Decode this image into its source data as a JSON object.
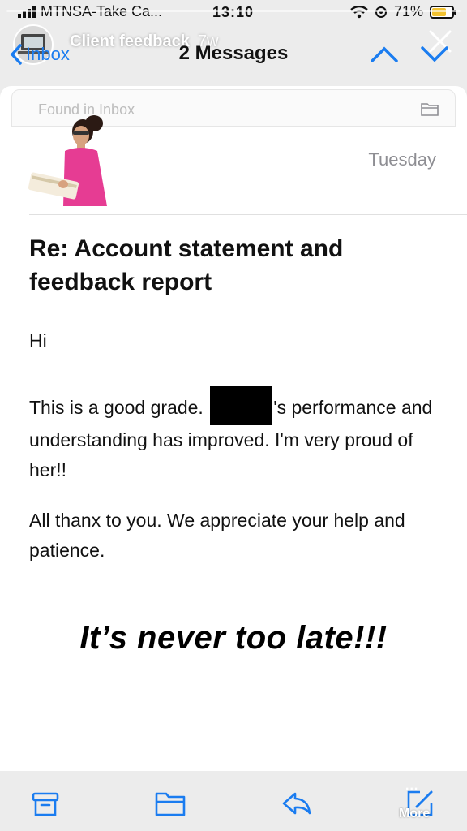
{
  "status_bar": {
    "carrier": "MTNSA-Take Ca...",
    "time": "13:10",
    "battery": "71%",
    "battery_level": 0.71
  },
  "story": {
    "title": "Client feedback",
    "age": "7w",
    "close_icon": "close-icon"
  },
  "nav": {
    "back_label": "Inbox",
    "title": "2 Messages",
    "up_icon": "chevron-up-icon",
    "down_icon": "chevron-down-icon"
  },
  "message": {
    "found_in": "Found in Inbox",
    "date": "Tuesday",
    "subject": "Re:  Account statement and feedback report",
    "greeting": "Hi",
    "para1_start": "This is a good grade.",
    "para1_end": "'s performance and understanding has improved. I'm very proud of her!!",
    "para2": "All thanx to you. We appreciate your help and patience."
  },
  "overlay_text": "It’s never too late!!!",
  "toolbar": {
    "more_label": "More",
    "more_dots": "...",
    "icons": [
      "archive-icon",
      "folder-icon",
      "reply-icon",
      "compose-icon"
    ]
  },
  "colors": {
    "accent": "#1a7cf0",
    "background": "#ececec",
    "card": "#ffffff",
    "date_gray": "#8e8e93"
  }
}
